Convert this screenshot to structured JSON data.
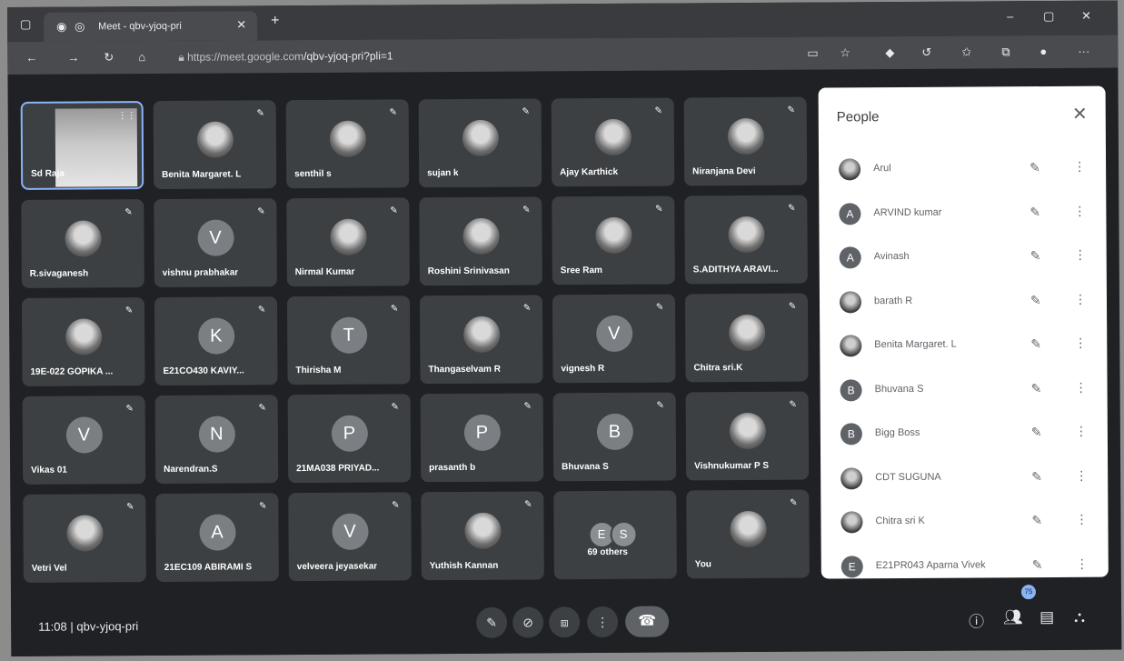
{
  "browser": {
    "tab_title": "Meet - qbv-yjoq-pri",
    "url_host": "https://meet.google.com",
    "url_path": "/qbv-yjoq-pri?pli=1"
  },
  "tiles": [
    {
      "name": "Sd Raja",
      "kind": "video",
      "speaking": true
    },
    {
      "name": "Benita Margaret. L",
      "kind": "photo"
    },
    {
      "name": "senthil s",
      "kind": "photo"
    },
    {
      "name": "sujan k",
      "kind": "photo"
    },
    {
      "name": "Ajay Karthick",
      "kind": "photo"
    },
    {
      "name": "Niranjana Devi",
      "kind": "photo"
    },
    {
      "name": "R.sivaganesh",
      "kind": "photo"
    },
    {
      "name": "vishnu prabhakar",
      "kind": "letter",
      "letter": "V"
    },
    {
      "name": "Nirmal Kumar",
      "kind": "photo"
    },
    {
      "name": "Roshini Srinivasan",
      "kind": "photo"
    },
    {
      "name": "Sree Ram",
      "kind": "photo"
    },
    {
      "name": "S.ADITHYA ARAVI...",
      "kind": "photo"
    },
    {
      "name": "19E-022 GOPIKA ...",
      "kind": "photo"
    },
    {
      "name": "E21CO430 KAVIY...",
      "kind": "letter",
      "letter": "K"
    },
    {
      "name": "Thirisha M",
      "kind": "letter",
      "letter": "T"
    },
    {
      "name": "Thangaselvam R",
      "kind": "photo"
    },
    {
      "name": "vignesh R",
      "kind": "letter",
      "letter": "V"
    },
    {
      "name": "Chitra sri.K",
      "kind": "photo"
    },
    {
      "name": "Vikas 01",
      "kind": "letter",
      "letter": "V"
    },
    {
      "name": "Narendran.S",
      "kind": "letter",
      "letter": "N"
    },
    {
      "name": "21MA038 PRIYAD...",
      "kind": "letter",
      "letter": "P"
    },
    {
      "name": "prasanth b",
      "kind": "letter",
      "letter": "P"
    },
    {
      "name": "Bhuvana S",
      "kind": "letter",
      "letter": "B"
    },
    {
      "name": "Vishnukumar P S",
      "kind": "photo"
    },
    {
      "name": "Vetri Vel",
      "kind": "photo"
    },
    {
      "name": "21EC109 ABIRAMI S",
      "kind": "letter",
      "letter": "A"
    },
    {
      "name": "velveera jeyasekar",
      "kind": "letter",
      "letter": "V"
    },
    {
      "name": "Yuthish Kannan",
      "kind": "photo"
    },
    {
      "name": "69 others",
      "kind": "others",
      "letters": [
        "E",
        "S"
      ]
    },
    {
      "name": "You",
      "kind": "photo"
    }
  ],
  "people_panel": {
    "title": "People",
    "close_icon": "close-icon",
    "rows": [
      {
        "name": "Arul",
        "avatar": "img"
      },
      {
        "name": "ARVIND kumar",
        "avatar": "A"
      },
      {
        "name": "Avinash",
        "avatar": "A"
      },
      {
        "name": "barath R",
        "avatar": "img"
      },
      {
        "name": "Benita Margaret. L",
        "avatar": "img"
      },
      {
        "name": "Bhuvana S",
        "avatar": "B"
      },
      {
        "name": "Bigg Boss",
        "avatar": "B"
      },
      {
        "name": "CDT SUGUNA",
        "avatar": "img"
      },
      {
        "name": "Chitra sri K",
        "avatar": "img"
      },
      {
        "name": "E21PR043 Aparna Vivek",
        "avatar": "E"
      }
    ]
  },
  "bottom_bar": {
    "time": "11:08",
    "separator": "|",
    "meeting_code": "qbv-yjoq-pri",
    "participant_badge": "75"
  }
}
